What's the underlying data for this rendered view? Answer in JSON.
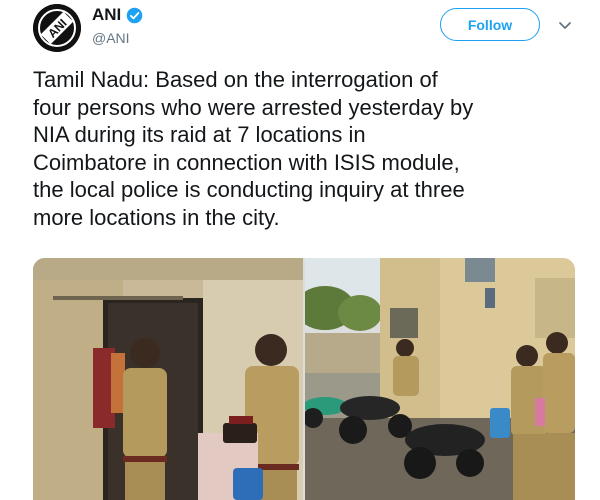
{
  "tweet": {
    "author": {
      "display_name": "ANI",
      "handle": "@ANI",
      "verified": true,
      "avatar_text": "ANI",
      "avatar_icon": "ani-logo-icon"
    },
    "follow_label": "Follow",
    "menu_icon": "chevron-down-icon",
    "text_lines": [
      "Tamil Nadu: Based on the interrogation of",
      "four persons who were arrested yesterday by",
      "NIA during its raid at 7 locations in",
      "Coimbatore in connection with ISIS module,",
      "the local police is conducting inquiry at three",
      "more locations in the city."
    ],
    "media": [
      {
        "name": "photo-officers-doorway"
      },
      {
        "name": "photo-officers-courtyard"
      }
    ]
  },
  "colors": {
    "brand_blue": "#1da1f2",
    "text": "#14171a",
    "secondary": "#657786"
  }
}
